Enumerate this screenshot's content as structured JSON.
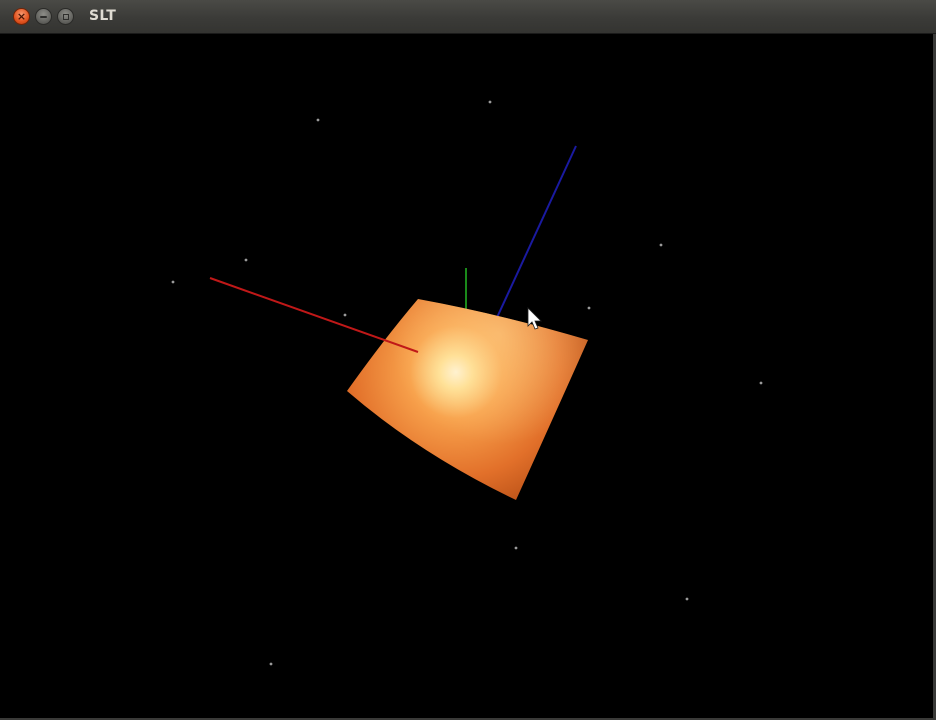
{
  "window": {
    "title": "SLT",
    "close_glyph": "×",
    "icons": {
      "close": "close-icon",
      "minimize": "minimize-icon",
      "maximize": "maximize-icon",
      "cursor": "mouse-pointer-icon"
    }
  },
  "scene": {
    "background": "#000000",
    "axis_colors": {
      "x": "#c01818",
      "y": "#1a8a1a",
      "z": "#1a1aa0"
    },
    "surface_colors": {
      "highlight": "#fff8d8",
      "mid": "#f08a3a",
      "shadow": "#7a2e08"
    }
  }
}
